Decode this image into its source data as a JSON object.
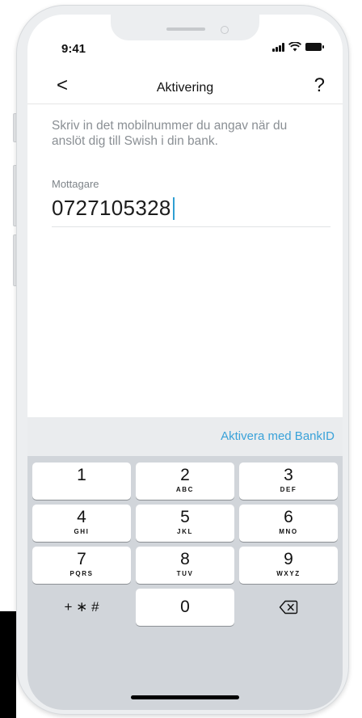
{
  "status": {
    "time": "9:41"
  },
  "nav": {
    "back": "<",
    "title": "Aktivering",
    "help": "?"
  },
  "content": {
    "description": "Skriv in det mobilnummer du angav när du anslöt dig till Swish i din bank.",
    "field_label": "Mottagare",
    "field_value": "0727105328"
  },
  "keyboard": {
    "action": "Aktivera med BankID",
    "keys": [
      {
        "num": "1",
        "letters": ""
      },
      {
        "num": "2",
        "letters": "ABC"
      },
      {
        "num": "3",
        "letters": "DEF"
      },
      {
        "num": "4",
        "letters": "GHI"
      },
      {
        "num": "5",
        "letters": "JKL"
      },
      {
        "num": "6",
        "letters": "MNO"
      },
      {
        "num": "7",
        "letters": "PQRS"
      },
      {
        "num": "8",
        "letters": "TUV"
      },
      {
        "num": "9",
        "letters": "WXYZ"
      },
      {
        "num": "+ ∗ #",
        "letters": ""
      },
      {
        "num": "0",
        "letters": ""
      }
    ]
  },
  "icons": {
    "signal": "cellular-signal-icon",
    "wifi": "wifi-icon",
    "battery": "battery-icon",
    "delete": "backspace-icon"
  }
}
